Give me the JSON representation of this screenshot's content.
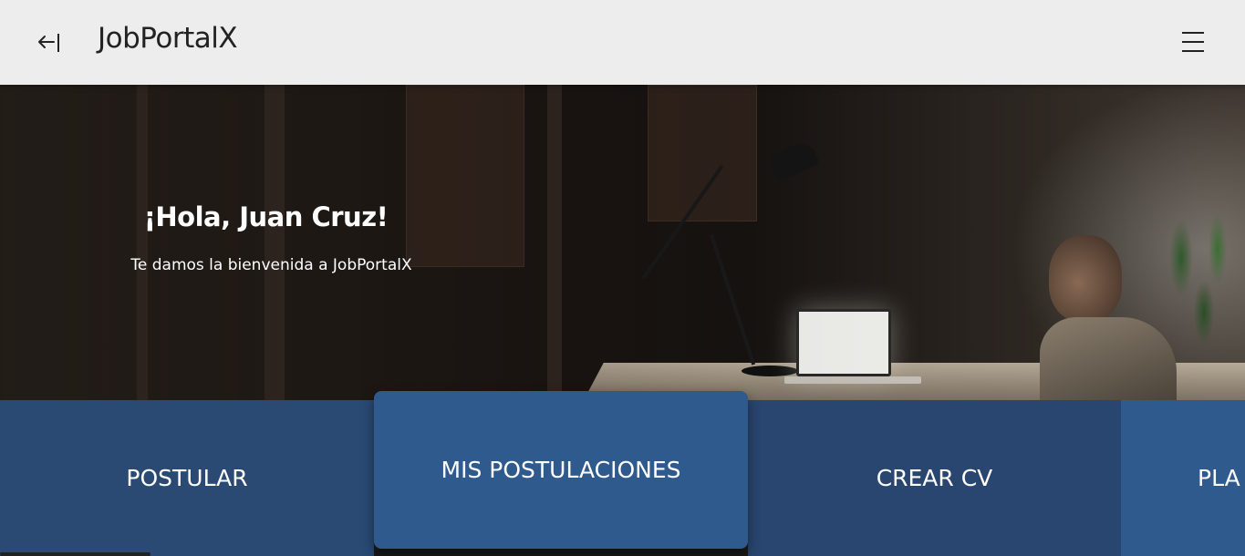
{
  "header": {
    "back_icon": "back-arrow-bar-icon",
    "brand": "JobPortalX",
    "menu_icon": "hamburger-menu-icon"
  },
  "hero": {
    "greeting": "¡Hola, Juan Cruz!",
    "subtitle": "Te damos la bienvenida a JobPortalX"
  },
  "tiles": {
    "postular": "POSTULAR",
    "mis_postulaciones": "MIS POSTULACIONES",
    "crear_cv": "CREAR CV",
    "planes": "PLA"
  },
  "colors": {
    "topbar": "#ededed",
    "tile_dark": "#2a4a74",
    "tile_active": "#2f5a8d",
    "tile_light": "#2e5a8e"
  }
}
